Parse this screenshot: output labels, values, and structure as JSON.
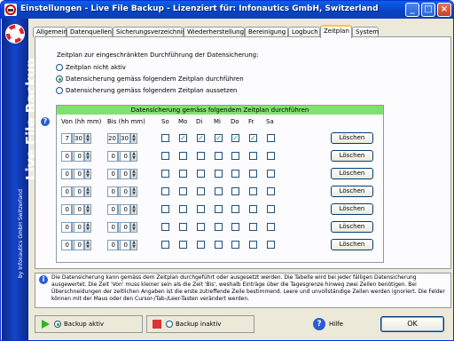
{
  "window": {
    "title": "Einstellungen - Live File Backup - Lizenziert für: Infonautics GmbH, Switzerland",
    "min_label": "_",
    "max_label": "□",
    "close_label": "×"
  },
  "sidebar": {
    "brand": "Live File Backup",
    "sub": "by Infonautics GmbH Switzerland"
  },
  "tabs": [
    {
      "label": "Allgemein"
    },
    {
      "label": "Datenquellen"
    },
    {
      "label": "Sicherungsverzeichnis"
    },
    {
      "label": "Wiederherstellung"
    },
    {
      "label": "Bereinigung"
    },
    {
      "label": "Logbuch"
    },
    {
      "label": "Zeitplan",
      "active": true
    },
    {
      "label": "System"
    }
  ],
  "schedule": {
    "intro": "Zeitplan zur eingeschränkten Durchführung der Datensicherung:",
    "options": [
      {
        "label": "Zeitplan nicht aktiv",
        "selected": false
      },
      {
        "label": "Datensicherung gemäss folgendem Zeitplan durchführen",
        "selected": true
      },
      {
        "label": "Datensicherung gemäss folgendem Zeitplan aussetzen",
        "selected": false
      }
    ],
    "table_header": "Datensicherung gemäss folgendem Zeitplan durchführen",
    "col_from": "Von (hh mm)",
    "col_to": "Bis (hh mm)",
    "days": [
      "So",
      "Mo",
      "Di",
      "Mi",
      "Do",
      "Fr",
      "Sa"
    ],
    "delete_label": "Löschen",
    "rows": [
      {
        "from_h": "7",
        "from_m": "30",
        "to_h": "20",
        "to_m": "30",
        "checks": [
          false,
          true,
          true,
          true,
          true,
          true,
          false
        ]
      },
      {
        "from_h": "0",
        "from_m": "0",
        "to_h": "0",
        "to_m": "0",
        "checks": [
          false,
          false,
          false,
          false,
          false,
          false,
          false
        ]
      },
      {
        "from_h": "0",
        "from_m": "0",
        "to_h": "0",
        "to_m": "0",
        "checks": [
          false,
          false,
          false,
          false,
          false,
          false,
          false
        ]
      },
      {
        "from_h": "0",
        "from_m": "0",
        "to_h": "0",
        "to_m": "0",
        "checks": [
          false,
          false,
          false,
          false,
          false,
          false,
          false
        ]
      },
      {
        "from_h": "0",
        "from_m": "0",
        "to_h": "0",
        "to_m": "0",
        "checks": [
          false,
          false,
          false,
          false,
          false,
          false,
          false
        ]
      },
      {
        "from_h": "0",
        "from_m": "0",
        "to_h": "0",
        "to_m": "0",
        "checks": [
          false,
          false,
          false,
          false,
          false,
          false,
          false
        ]
      },
      {
        "from_h": "0",
        "from_m": "0",
        "to_h": "0",
        "to_m": "0",
        "checks": [
          false,
          false,
          false,
          false,
          false,
          false,
          false
        ]
      }
    ]
  },
  "info": {
    "text": "Die Datensicherung kann gemäss dem Zeitplan durchgeführt oder ausgesetzt werden. Die Tabelle wird bei jeder fälligen Datensicherung ausgewertet. Die Zeit 'Von' muss kleiner sein als die Zeit 'Bis', weshalb Einträge über die Tagesgrenze hinweg zwei Zeilen benötigen. Bei Überschneidungen der zeitlichen Angaben ist die erste zutreffende Zeile bestimmend. Leere und unvollständige Zeilen werden ignoriert. Die Felder können mit der Maus oder den Cursor-/Tab-/Leer-Tasten verändert werden."
  },
  "footer": {
    "backup_active": "Backup aktiv",
    "backup_inactive": "Backup inaktiv",
    "help": "Hilfe",
    "ok": "OK"
  },
  "colors": {
    "title_bar": "#0a4fd6",
    "sidebar": "#1644c8",
    "table_header": "#7ee36a",
    "active_tab_accent": "#ffc83c"
  }
}
